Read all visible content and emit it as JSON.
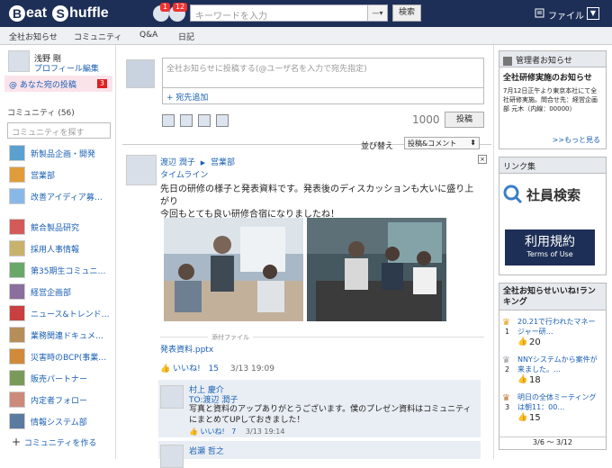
{
  "header": {
    "logo_b": "B",
    "logo_rest": "eat",
    "logo_s": "S",
    "logo_rest2": "huffle",
    "badge1": "1",
    "badge2": "12",
    "search_placeholder": "キーワードを入力",
    "search_button": "検索",
    "file_label": "ファイル",
    "menu_icon": "▼"
  },
  "nav": [
    "全社お知らせ",
    "コミュニティ",
    "Q&A",
    "日記"
  ],
  "profile": {
    "name": "浅野 剛",
    "edit": "プロフィール編集",
    "my_posts": "あなた宛の投稿",
    "my_posts_count": "3"
  },
  "community": {
    "heading": "コミュニティ (56)",
    "search_placeholder": "コミュニティを探す",
    "items": [
      "新製品企画・開発",
      "営業部",
      "改善アイディア募…",
      "競合製品研究",
      "採用人事情報",
      "第35期生コミュニ…",
      "経営企画部",
      "ニュース&トレンド…",
      "業務関連ドキュメ…",
      "災害時のBCP(事業…",
      "販売パートナー",
      "内定者フォロー",
      "情報システム部"
    ],
    "add": "コミュニティを作る"
  },
  "composer": {
    "placeholder": "全社お知らせに投稿する(@ユーザ名を入力で宛先指定)",
    "add_recipient": "+ 宛先追加",
    "count": "1000",
    "post_button": "投稿"
  },
  "sort": {
    "label": "並び替え",
    "value": "投稿&コメント"
  },
  "feed": {
    "author": "渡辺 潤子",
    "arrow": "▶",
    "group": "営業部",
    "timeline": "タイムライン",
    "text1": "先日の研修の様子と発表資料です。発表後のディスカッションも大いに盛り上がり",
    "text2": "今回もとても良い研修合宿になりましたね！",
    "attach_label": "添付ファイル",
    "attach": "発表資料.pptx",
    "like": "いいね!",
    "like_count": "15",
    "date": "3/13 19:09",
    "close": "×"
  },
  "replies": [
    {
      "name": "村上 慶介",
      "to": "TO:渡辺 潤子",
      "text": "写真と資料のアップありがとうございます。僕のプレゼン資料はコミュニティにまとめてUPしておきました！",
      "like": "いいね!",
      "like_count": "7",
      "date": "3/13 19:14"
    },
    {
      "name": "岩瀬 哲之"
    }
  ],
  "admin": {
    "title": "管理者お知らせ",
    "headline": "全社研修実施のお知らせ",
    "body": "7月12日正午より東京本社にて全社研修実施。問合せ先：経営企画部 元木（内線：00000）",
    "more": ">>もっと見る"
  },
  "links": {
    "title": "リンク集",
    "search": "社員検索",
    "terms": "利用規約",
    "terms_en": "Terms of Use"
  },
  "ranking": {
    "title": "全社お知らせいいね!ランキング",
    "items": [
      {
        "rank": "1",
        "title": "20.21で行われたマネージャー研…",
        "count": "20"
      },
      {
        "rank": "2",
        "title": "NNYシステムから案件が来ました。…",
        "count": "18"
      },
      {
        "rank": "3",
        "title": "明日の全体ミーティングは朝11：00…",
        "count": "15"
      }
    ],
    "range": "3/6 〜 3/12"
  },
  "colors": {
    "header": "#1e2f57",
    "link": "#1a5fb4",
    "badge": "#e33"
  }
}
